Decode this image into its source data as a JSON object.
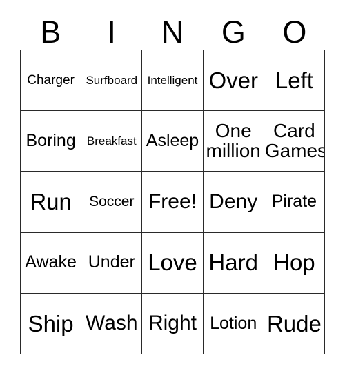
{
  "card": {
    "header_letters": [
      "B",
      "I",
      "N",
      "G",
      "O"
    ],
    "rows": [
      [
        {
          "text": "Charger",
          "size": "fs-xs"
        },
        {
          "text": "Surfboard",
          "size": "fs-xxs"
        },
        {
          "text": "Intelligent",
          "size": "fs-xxs"
        },
        {
          "text": "Over",
          "size": "fs-xxl"
        },
        {
          "text": "Left",
          "size": "fs-xxl"
        }
      ],
      [
        {
          "text": "Boring",
          "size": "fs-m"
        },
        {
          "text": "Breakfast",
          "size": "fs-xxs"
        },
        {
          "text": "Asleep",
          "size": "fs-m"
        },
        {
          "text": "One\nmillion",
          "size": "fs-l"
        },
        {
          "text": "Card\nGames",
          "size": "fs-l"
        }
      ],
      [
        {
          "text": "Run",
          "size": "fs-xxl"
        },
        {
          "text": "Soccer",
          "size": "fs-s"
        },
        {
          "text": "Free!",
          "size": "fs-xl"
        },
        {
          "text": "Deny",
          "size": "fs-xl"
        },
        {
          "text": "Pirate",
          "size": "fs-m"
        }
      ],
      [
        {
          "text": "Awake",
          "size": "fs-m"
        },
        {
          "text": "Under",
          "size": "fs-m"
        },
        {
          "text": "Love",
          "size": "fs-xxl"
        },
        {
          "text": "Hard",
          "size": "fs-xxl"
        },
        {
          "text": "Hop",
          "size": "fs-xxl"
        }
      ],
      [
        {
          "text": "Ship",
          "size": "fs-xxl"
        },
        {
          "text": "Wash",
          "size": "fs-xl"
        },
        {
          "text": "Right",
          "size": "fs-xl"
        },
        {
          "text": "Lotion",
          "size": "fs-m"
        },
        {
          "text": "Rude",
          "size": "fs-xxl"
        }
      ]
    ],
    "colors": {
      "background": "#ffffff",
      "text": "#000000",
      "grid_line": "#2a2a2a"
    }
  }
}
